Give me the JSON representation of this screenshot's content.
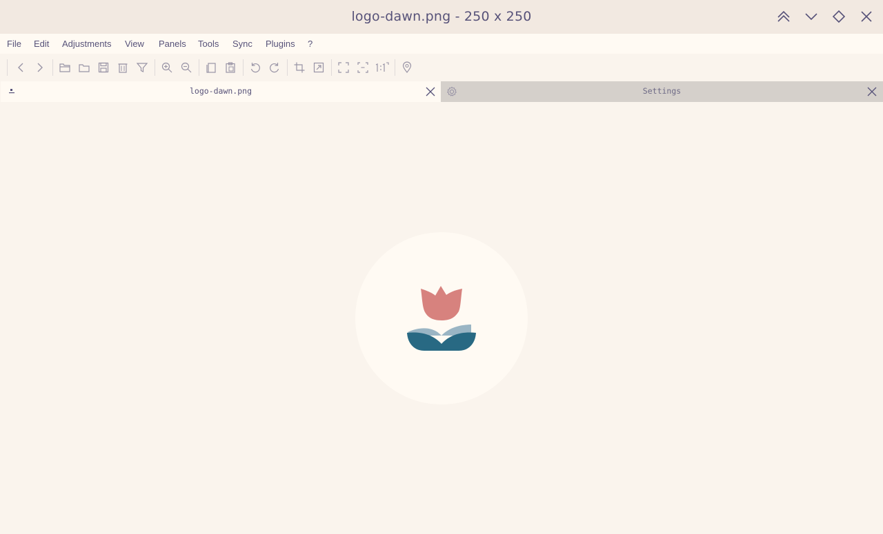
{
  "window": {
    "title": "logo-dawn.png - 250 x 250",
    "buttons": [
      {
        "name": "minimize-up-icon"
      },
      {
        "name": "chevron-down-icon"
      },
      {
        "name": "maximize-diamond-icon"
      },
      {
        "name": "close-icon"
      }
    ]
  },
  "menu": {
    "items": [
      "File",
      "Edit",
      "Adjustments",
      "View",
      "Panels",
      "Tools",
      "Sync",
      "Plugins",
      "?"
    ]
  },
  "toolbar": {
    "icons": [
      "back-arrow-icon",
      "forward-arrow-icon",
      "open-folder-icon",
      "folder-icon",
      "save-icon",
      "delete-icon",
      "filter-icon",
      "zoom-in-icon",
      "zoom-out-icon",
      "copy-icon",
      "paste-icon",
      "rotate-left-icon",
      "rotate-right-icon",
      "crop-icon",
      "resize-icon",
      "fullscreen-icon",
      "fit-window-icon",
      "actual-size-icon",
      "location-pin-icon"
    ]
  },
  "tabs": [
    {
      "label": "logo-dawn.png",
      "active": true,
      "icon": "image-file-icon"
    },
    {
      "label": "Settings",
      "active": false,
      "icon": "gear-icon"
    }
  ],
  "image": {
    "colors": {
      "background_circle": "#fffaf3",
      "petal": "#d7827e",
      "leaf_light": "#9ab5c4",
      "leaf_dark": "#286983"
    }
  },
  "theme": {
    "base": "#faf4ed",
    "surface": "#fffaf3",
    "overlay": "#f2e9e1",
    "text": "#575279",
    "muted": "#9893a5"
  }
}
